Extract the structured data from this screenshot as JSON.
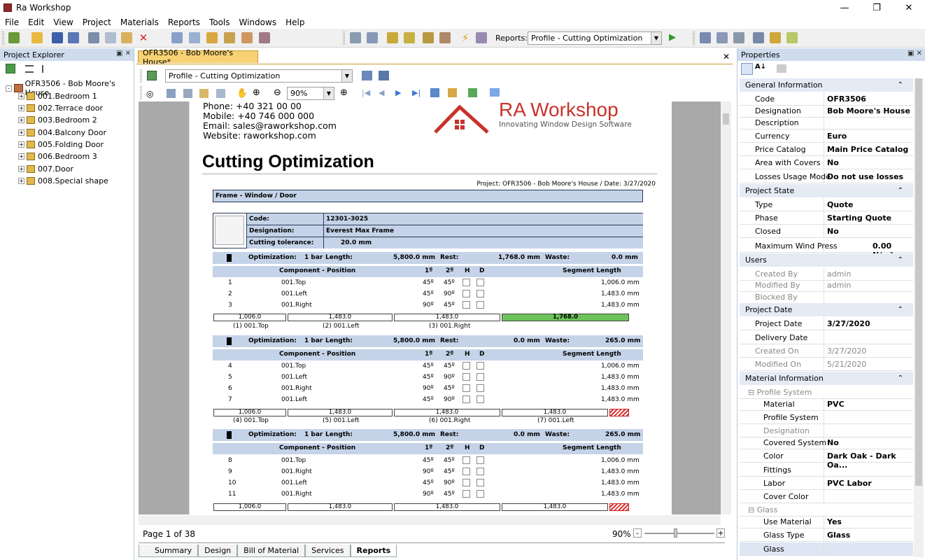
{
  "window": {
    "title": "Ra Workshop"
  },
  "menu": [
    "File",
    "Edit",
    "View",
    "Project",
    "Materials",
    "Reports",
    "Tools",
    "Windows",
    "Help"
  ],
  "toolbar": {
    "reports_label": "Reports:",
    "report_select": "Profile - Cutting Optimization"
  },
  "explorer": {
    "title": "Project Explorer",
    "root": "OFR3506 - Bob Moore's House",
    "items": [
      "001.Bedroom 1",
      "002.Terrace door",
      "003.Bedroom 2",
      "004.Balcony Door",
      "005.Folding Door",
      "006.Bedroom 3",
      "007.Door",
      "008.Special shape"
    ]
  },
  "document": {
    "tab": "OFR3506 - Bob Moore's House*",
    "profile_select": "Profile - Cutting Optimization",
    "zoom": "90%",
    "page_info": "Page 1 of 38",
    "zoom_status": "90%",
    "bottom_tabs": [
      "Summary",
      "Design",
      "Bill of Material",
      "Services",
      "Reports"
    ]
  },
  "report": {
    "contact": [
      "Phone: +40 321 00 00",
      "Mobile: +40 746 000 000",
      "Email: sales@raworkshop.com",
      "Website: raworkshop.com"
    ],
    "logo_title": "RA Workshop",
    "logo_sub": "Innovating Window Design Software",
    "heading": "Cutting Optimization",
    "project_line": "Project: OFR3506 - Bob Moore's House / Date: 3/27/2020",
    "section": "Frame - Window / Door",
    "code_lbl": "Code:",
    "code": "12301-3025",
    "desig_lbl": "Designation:",
    "desig": "Everest Max Frame",
    "tol_lbl": "Cutting tolerance:",
    "tol": "20.0 mm",
    "opt_lbl": "Optimization:",
    "len_lbl": "Length:",
    "rest_lbl": "Rest:",
    "waste_lbl": "Waste:",
    "col_comp": "Component - Position",
    "col_1": "1º",
    "col_2": "2º",
    "col_h": "H",
    "col_d": "D",
    "col_seg": "Segment Length",
    "groups": [
      {
        "bars": "1 bar",
        "length": "5,800.0 mm",
        "rest": "1,768.0 mm",
        "waste": "0.0 mm",
        "rows": [
          [
            "1",
            "001.Top",
            "45º",
            "45º",
            "1,006.0 mm"
          ],
          [
            "2",
            "001.Left",
            "45º",
            "90º",
            "1,483.0 mm"
          ],
          [
            "3",
            "001.Right",
            "90º",
            "45º",
            "1,483.0 mm"
          ]
        ],
        "segs": [
          "1,006.0",
          "1,483.0",
          "1,483.0",
          "1,768.0"
        ],
        "caps": [
          "(1) 001.Top",
          "(2) 001.Left",
          "(3) 001.Right"
        ]
      },
      {
        "bars": "1 bar",
        "length": "5,800.0 mm",
        "rest": "0.0 mm",
        "waste": "265.0 mm",
        "rows": [
          [
            "4",
            "001.Top",
            "45º",
            "45º",
            "1,006.0 mm"
          ],
          [
            "5",
            "001.Left",
            "45º",
            "90º",
            "1,483.0 mm"
          ],
          [
            "6",
            "001.Right",
            "90º",
            "45º",
            "1,483.0 mm"
          ],
          [
            "7",
            "001.Left",
            "45º",
            "90º",
            "1,483.0 mm"
          ]
        ],
        "segs": [
          "1,006.0",
          "1,483.0",
          "1,483.0",
          "1,483.0"
        ],
        "caps": [
          "(4) 001.Top",
          "(5) 001.Left",
          "(6) 001.Right",
          "(7) 001.Left"
        ]
      },
      {
        "bars": "1 bar",
        "length": "5,800.0 mm",
        "rest": "0.0 mm",
        "waste": "265.0 mm",
        "rows": [
          [
            "8",
            "001.Top",
            "45º",
            "45º",
            "1,006.0 mm"
          ],
          [
            "9",
            "001.Right",
            "90º",
            "45º",
            "1,483.0 mm"
          ],
          [
            "10",
            "001.Left",
            "45º",
            "90º",
            "1,483.0 mm"
          ],
          [
            "11",
            "001.Right",
            "90º",
            "45º",
            "1,483.0 mm"
          ]
        ],
        "segs": [
          "1,006.0",
          "1,483.0",
          "1,483.0",
          "1,483.0"
        ],
        "caps": []
      }
    ]
  },
  "properties": {
    "title": "Properties",
    "general": {
      "title": "General Information",
      "rows": [
        [
          "Code",
          "OFR3506"
        ],
        [
          "Designation",
          "Bob Moore's House"
        ],
        [
          "Description",
          ""
        ],
        [
          "Currency",
          "Euro"
        ],
        [
          "Price Catalog",
          "Main Price Catalog"
        ],
        [
          "Area with Covers",
          "No"
        ],
        [
          "Losses Usage Mode",
          "Do not use losses a..."
        ]
      ]
    },
    "state": {
      "title": "Project State",
      "rows": [
        [
          "Type",
          "Quote"
        ],
        [
          "Phase",
          "Starting Quote"
        ],
        [
          "Closed",
          "No"
        ],
        [
          "Maximum Wind Press",
          "0.00 N/m²"
        ]
      ]
    },
    "users": {
      "title": "Users",
      "rows": [
        [
          "Created By",
          "admin"
        ],
        [
          "Modified By",
          "admin"
        ],
        [
          "Blocked By",
          ""
        ]
      ]
    },
    "date": {
      "title": "Project Date",
      "rows": [
        [
          "Project Date",
          "3/27/2020"
        ],
        [
          "Delivery Date",
          ""
        ],
        [
          "Created On",
          "3/27/2020"
        ],
        [
          "Modified On",
          "5/21/2020"
        ]
      ]
    },
    "material": {
      "title": "Material Information",
      "profile_system": "Profile System",
      "glass": "Glass",
      "rows1": [
        [
          "Material",
          "PVC"
        ],
        [
          "Profile System",
          ""
        ],
        [
          "Designation",
          ""
        ],
        [
          "Covered System",
          "No"
        ],
        [
          "Color",
          "Dark Oak - Dark Oa..."
        ],
        [
          "Fittings",
          ""
        ],
        [
          "Labor",
          "PVC Labor"
        ],
        [
          "Cover Color",
          ""
        ]
      ],
      "rows2": [
        [
          "Use Material",
          "Yes"
        ],
        [
          "Glass Type",
          "Glass"
        ],
        [
          "Glass",
          ""
        ]
      ]
    }
  }
}
